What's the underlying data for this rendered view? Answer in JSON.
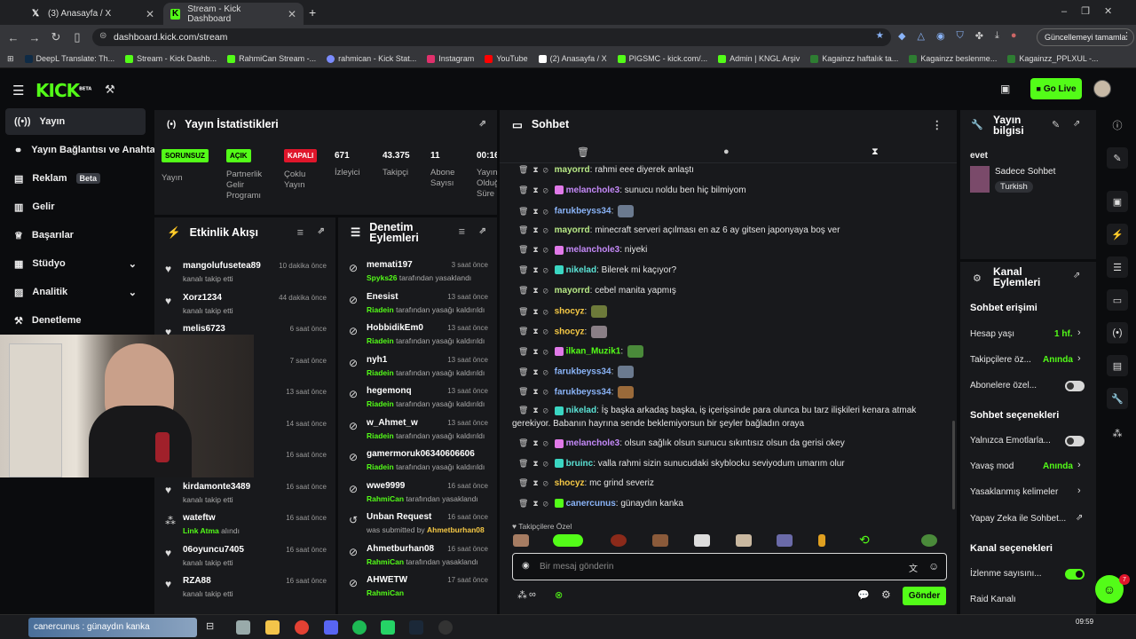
{
  "browser": {
    "tabs": [
      {
        "label": "(3) Anasayfa / X",
        "icon": "x-logo-icon"
      },
      {
        "label": "Stream - Kick Dashboard",
        "icon": "kick-logo-icon"
      }
    ],
    "url": "dashboard.kick.com/stream",
    "update_label": "Güncellemeyi tamamla",
    "bookmarks": [
      "DeepL Translate: Th...",
      "Stream - Kick Dashb...",
      "RahmiCan Stream -...",
      "rahmican - Kick Stat...",
      "Instagram",
      "YouTube",
      "(2) Anasayfa / X",
      "PIGSMC - kick.com/...",
      "Admin | KNGL Arşiv",
      "Kagainzz haftalık ta...",
      "Kagainzz beslenme...",
      "Kagainzz_PPLXUL -..."
    ]
  },
  "header": {
    "logo": "KICK",
    "logo_sup": "BETA",
    "go_live": "Go Live"
  },
  "sidebar": {
    "items": [
      {
        "label": "Yayın",
        "icon": "broadcast-icon"
      },
      {
        "label": "Yayın Bağlantısı ve Anahtar",
        "icon": "link-icon"
      },
      {
        "label": "Reklam",
        "icon": "ad-icon",
        "badge": "Beta"
      },
      {
        "label": "Gelir",
        "icon": "wallet-icon"
      },
      {
        "label": "Başarılar",
        "icon": "trophy-icon"
      },
      {
        "label": "Stüdyo",
        "icon": "studio-icon"
      },
      {
        "label": "Analitik",
        "icon": "chart-icon"
      },
      {
        "label": "Denetleme",
        "icon": "hammer-icon"
      }
    ]
  },
  "stats": {
    "title": "Yayın İstatistikleri",
    "items": [
      {
        "chip": "SORUNSUZ",
        "label": "Yayın"
      },
      {
        "chip": "AÇIK",
        "label": "Partnerlik Gelir Programı"
      },
      {
        "chip": "KAPALI",
        "label": "Çoklu Yayın"
      },
      {
        "value": "671",
        "label": "İzleyici"
      },
      {
        "value": "43.375",
        "label": "Takipçi"
      },
      {
        "value": "11",
        "label": "Abone Sayısı"
      },
      {
        "value": "00:16",
        "label": "Yayın Olduğu Süre"
      }
    ]
  },
  "activity": {
    "title": "Etkinlik Akışı",
    "items": [
      {
        "name": "mangolufusetea89",
        "sub": "kanalı takip etti",
        "time": "10 dakika önce"
      },
      {
        "name": "Xorz1234",
        "sub": "kanalı takip etti",
        "time": "44 dakika önce"
      },
      {
        "name": "melis6723",
        "sub": "",
        "time": "6 saat önce"
      },
      {
        "name": "",
        "sub": "",
        "time": "7 saat önce"
      },
      {
        "name": "",
        "sub": "",
        "time": "13 saat önce"
      },
      {
        "name": "",
        "sub": "",
        "time": "14 saat önce"
      },
      {
        "name": "",
        "sub": "",
        "time": "16 saat önce"
      },
      {
        "name": "kirdamonte3489",
        "sub": "kanalı takip etti",
        "time": "16 saat önce"
      },
      {
        "name": "wateftw",
        "sub": "Link Atma",
        "sub2": "alındı",
        "time": "16 saat önce"
      },
      {
        "name": "06oyuncu7405",
        "sub": "kanalı takip etti",
        "time": "16 saat önce"
      },
      {
        "name": "RZA88",
        "sub": "kanalı takip etti",
        "time": "16 saat önce"
      }
    ]
  },
  "moderation": {
    "title": "Denetim Eylemleri",
    "items": [
      {
        "name": "memati197",
        "actor": "Spyks26",
        "action": "tarafından yasaklandı",
        "time": "3 saat önce"
      },
      {
        "name": "Enesist",
        "actor": "Riadein",
        "action": "tarafından yasağı kaldırıldı",
        "time": "13 saat önce"
      },
      {
        "name": "HobbidikEm0",
        "actor": "Riadein",
        "action": "tarafından yasağı kaldırıldı",
        "time": "13 saat önce"
      },
      {
        "name": "nyh1",
        "actor": "Riadein",
        "action": "tarafından yasağı kaldırıldı",
        "time": "13 saat önce"
      },
      {
        "name": "hegemonq",
        "actor": "Riadein",
        "action": "tarafından yasağı kaldırıldı",
        "time": "13 saat önce"
      },
      {
        "name": "w_Ahmet_w",
        "actor": "Riadein",
        "action": "tarafından yasağı kaldırıldı",
        "time": "13 saat önce"
      },
      {
        "name": "gamermoruk06340606606",
        "actor": "Riadein",
        "action": "tarafından yasağı kaldırıldı",
        "time": ""
      },
      {
        "name": "wwe9999",
        "actor": "RahmiCan",
        "action": "tarafından yasaklandı",
        "time": "16 saat önce"
      },
      {
        "name": "Unban Request",
        "actor": "Ahmetburhan08",
        "action": "was submitted by",
        "time": "16 saat önce"
      },
      {
        "name": "Ahmetburhan08",
        "actor": "RahmiCan",
        "action": "tarafından yasaklandı",
        "time": "16 saat önce"
      },
      {
        "name": "AHWETW",
        "actor": "RahmiCan",
        "action": "",
        "time": "17 saat önce"
      }
    ]
  },
  "chat": {
    "title": "Sohbet",
    "messages": [
      {
        "user": "mayorrd",
        "color": "#b8e986",
        "text": "rahmi eee diyerek anlaştı"
      },
      {
        "user": "melanchole3",
        "color": "#c58af9",
        "text": "sunucu noldu ben hiç bilmiyom",
        "badge": "#e079e8"
      },
      {
        "user": "farukbeyss34",
        "color": "#8ab4f8",
        "text": "",
        "emote": "#6b7a8f"
      },
      {
        "user": "mayorrd",
        "color": "#b8e986",
        "text": "minecraft serveri açılması en az 6 ay gitsen japonyaya boş ver"
      },
      {
        "user": "melanchole3",
        "color": "#c58af9",
        "text": "niyeki",
        "badge": "#e079e8"
      },
      {
        "user": "nikelad",
        "color": "#5be3d6",
        "text": "Bilerek mi kaçıyor?",
        "badge": "#3ad6c2"
      },
      {
        "user": "mayorrd",
        "color": "#b8e986",
        "text": "cebel manita yapmış"
      },
      {
        "user": "shocyz",
        "color": "#f6c945",
        "text": "",
        "emote": "#6d7a3a"
      },
      {
        "user": "shocyz",
        "color": "#f6c945",
        "text": "",
        "emote": "#8a7f86"
      },
      {
        "user": "ilkan_Muzik1",
        "color": "#53fc18",
        "text": "",
        "emote": "#4a8a3a",
        "badge": "#e079e8"
      },
      {
        "user": "farukbeyss34",
        "color": "#8ab4f8",
        "text": "",
        "emote": "#6b7a8f"
      },
      {
        "user": "farukbeyss34",
        "color": "#8ab4f8",
        "text": "",
        "emote": "#9a6a3a"
      },
      {
        "user": "nikelad",
        "color": "#5be3d6",
        "text": "İş başka arkadaş başka, iş içerişsinde para olunca bu tarz ilişkileri kenara atmak",
        "text2": "gerekiyor. Babanın hayrına sende beklemiyorsun bir şeyler bağladın oraya",
        "badge": "#3ad6c2"
      },
      {
        "user": "melanchole3",
        "color": "#c58af9",
        "text": "olsun sağlık olsun sunucu sıkıntısız olsun da gerisi okey",
        "badge": "#e079e8"
      },
      {
        "user": "bruinc",
        "color": "#5be3d6",
        "text": "valla rahmi sizin sunucudaki skyblocku seviyodum umarım olur",
        "badge": "#3ad6c2"
      },
      {
        "user": "shocyz",
        "color": "#f6c945",
        "text": "mc grind severiz"
      },
      {
        "user": "canercunus",
        "color": "#8ab4f8",
        "text": "günaydın kanka",
        "badge": "#53fc18"
      }
    ],
    "emote_label": "Takipçilere Özel",
    "input_placeholder": "Bir mesaj gönderin",
    "send_label": "Gönder"
  },
  "stream_info": {
    "title": "Yayın bilgisi",
    "stream_title": "evet",
    "category": "Sadece Sohbet",
    "tag": "Turkish"
  },
  "channel_actions": {
    "title": "Kanal Eylemleri",
    "chat_access": "Sohbet erişimi",
    "account_age": {
      "label": "Hesap yaşı",
      "value": "1 hf."
    },
    "followers_only": {
      "label": "Takipçilere öz...",
      "value": "Anında"
    },
    "subscribers_only": {
      "label": "Abonelere özel...",
      "on": false
    },
    "chat_options": "Sohbet seçenekleri",
    "emotes_only": {
      "label": "Yalnızca Emotlarla...",
      "on": false
    },
    "slow_mode": {
      "label": "Yavaş mod",
      "value": "Anında"
    },
    "banned_words": {
      "label": "Yasaklanmış kelimeler"
    },
    "ai_chat": {
      "label": "Yapay Zeka ile Sohbet..."
    },
    "channel_options": "Kanal seçenekleri",
    "viewer_count": {
      "label": "İzlenme sayısını...",
      "on": true
    },
    "raid": {
      "label": "Raid Kanalı"
    }
  },
  "taskbar": {
    "toast": "canercunus : günaydın kanka",
    "clock": "09:59",
    "support_count": "7"
  }
}
